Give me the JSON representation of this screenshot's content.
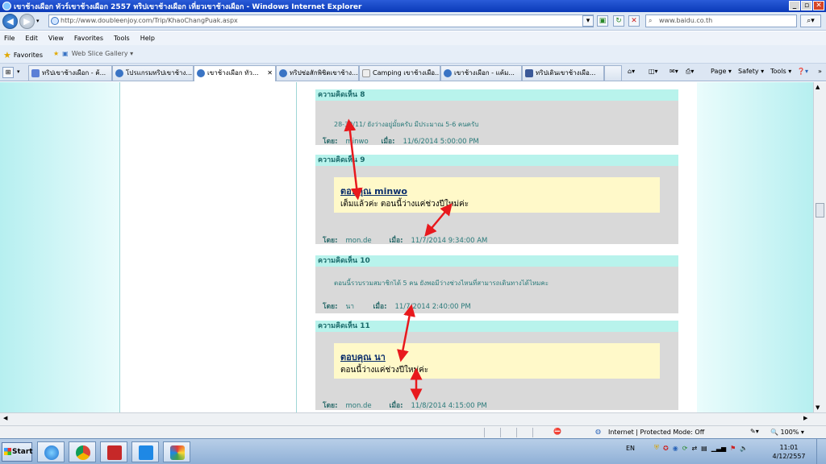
{
  "window": {
    "title": "เขาช้างเผือก ทัวร์เขาช้างเผือก 2557 ทริปเขาช้างเผือก เที่ยวเขาช้างเผือก - Windows Internet Explorer"
  },
  "address_bar": {
    "url": "http://www.doubleenjoy.com/Trip/KhaoChangPuak.aspx",
    "search_text": "www.baidu.co.th"
  },
  "menu": [
    "File",
    "Edit",
    "View",
    "Favorites",
    "Tools",
    "Help"
  ],
  "favorites_bar": {
    "favorites_label": "Favorites",
    "web_slice_label": "Web Slice Gallery ▾"
  },
  "tabs": [
    {
      "label": "ทริปเขาช้างเผือก - ค้..."
    },
    {
      "label": "โปรแกรมทริปเขาช้าง..."
    },
    {
      "label": "เขาช้างเผือก ทัว..."
    },
    {
      "label": "ทริปซ่อสักพิชิตเขาช้าง..."
    },
    {
      "label": "Camping เขาช้างเผือ..."
    },
    {
      "label": "เขาช้างเผือก - แค้ม..."
    },
    {
      "label": "ทริปเดินเขาช้างเผือ..."
    }
  ],
  "command_bar": {
    "page": "Page ▾",
    "safety": "Safety ▾",
    "tools": "Tools ▾"
  },
  "comments": [
    {
      "header": "ความคิดเห็น 8",
      "text": "28-30/11/ ยังว่างอยู่มั้ยครับ มีประมาณ 5-6 คนครับ",
      "by_label": "โดย:",
      "by": "minwo",
      "when_label": "เมื่อ:",
      "when": "11/6/2014 5:00:00 PM"
    },
    {
      "header": "ความคิดเห็น 9",
      "reply_title": "ตอบคุณ minwo",
      "reply_text": "เต็มแล้วค่ะ ตอนนี้ว่างแค่ช่วงปีใหม่ค่ะ",
      "by_label": "โดย:",
      "by": "mon.de",
      "when_label": "เมื่อ:",
      "when": "11/7/2014 9:34:00 AM"
    },
    {
      "header": "ความคิดเห็น 10",
      "text": "ตอนนี้รวบรวมสมาชิกได้ 5 คน ยังพอมีว่างช่วงไหนที่สามารถเดินทางได้ไหมคะ",
      "by_label": "โดย:",
      "by": "นา",
      "when_label": "เมื่อ:",
      "when": "11/7/2014 2:40:00 PM"
    },
    {
      "header": "ความคิดเห็น 11",
      "reply_title": "ตอบคุณ นา",
      "reply_text": "ตอนนี้ว่างแค่ช่วงปีใหม่ค่ะ",
      "by_label": "โดย:",
      "by": "mon.de",
      "when_label": "เมื่อ:",
      "when": "11/8/2014 4:15:00 PM"
    }
  ],
  "status_bar": {
    "zone": "Internet | Protected Mode: Off",
    "zoom": "100%"
  },
  "taskbar": {
    "start": "Start",
    "language": "EN",
    "time": "11:01",
    "date": "4/12/2557"
  },
  "annotation_color": "#e8191d"
}
